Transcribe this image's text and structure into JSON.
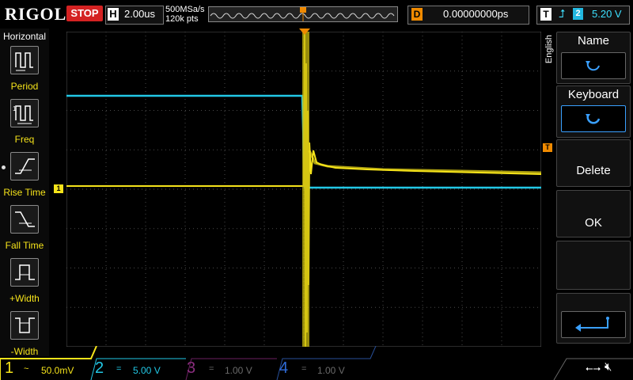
{
  "brand": "RIGOL",
  "run_state": "STOP",
  "timebase": {
    "letter": "H",
    "value": "2.00us",
    "sample_rate": "500MSa/s",
    "memory_depth": "120k pts"
  },
  "delay": {
    "letter": "D",
    "value": "0.00000000ps"
  },
  "trigger": {
    "letter": "T",
    "source": "2",
    "level": "5.20 V",
    "icon": "rising-edge-icon"
  },
  "left_menu": {
    "title": "Horizontal",
    "items": [
      {
        "label": "Period",
        "icon": "period-icon"
      },
      {
        "label": "Freq",
        "icon": "freq-icon"
      },
      {
        "label": "Rise Time",
        "icon": "rise-time-icon"
      },
      {
        "label": "Fall Time",
        "icon": "fall-time-icon"
      },
      {
        "label": "+Width",
        "icon": "plus-width-icon"
      },
      {
        "label": "-Width",
        "icon": "minus-width-icon"
      }
    ]
  },
  "right_menu": {
    "language": "English",
    "name_label": "Name",
    "keyboard_label": "Keyboard",
    "delete_label": "Delete",
    "ok_label": "OK"
  },
  "channels": [
    {
      "num": "1",
      "coupling": "~",
      "scale": "50.0mV",
      "color": "#f5e31a",
      "active": true
    },
    {
      "num": "2",
      "coupling": "=",
      "scale": "5.00 V",
      "color": "#22c8e6",
      "active": true
    },
    {
      "num": "3",
      "coupling": "=",
      "scale": "1.00 V",
      "color": "#b0379e",
      "active": false
    },
    {
      "num": "4",
      "coupling": "=",
      "scale": "1.00 V",
      "color": "#2f6bd6",
      "active": false
    }
  ],
  "markers": {
    "ch1_marker": "1",
    "trigger_marker": "T"
  },
  "colors": {
    "ch1": "#f5e31a",
    "ch2": "#22c8e6",
    "trigger": "#f08a00",
    "stop": "#d42222"
  }
}
